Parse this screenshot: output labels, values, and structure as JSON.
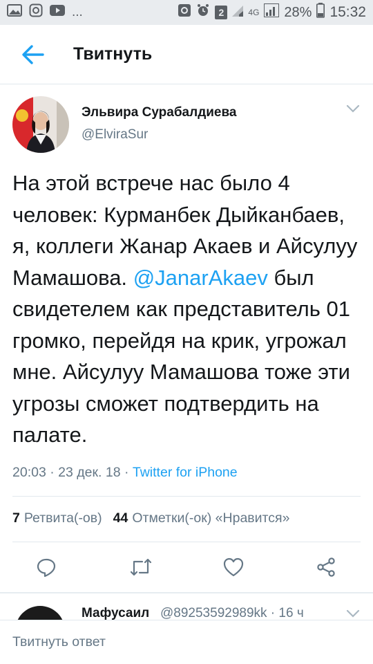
{
  "status_bar": {
    "left_icons": [
      "image-icon",
      "instagram-icon",
      "youtube-icon",
      "more-dots"
    ],
    "dots": "...",
    "sim_badge": "2",
    "network": "4G",
    "battery_percent": "28%",
    "time": "15:32"
  },
  "app_bar": {
    "title": "Твитнуть",
    "back_icon": "arrow-left-icon"
  },
  "tweet": {
    "author_name": "Эльвира Сурабалдиева",
    "author_handle": "@ElviraSur",
    "text_before": "На этой встрече нас было 4 человек: Курманбек Дыйканбаев, я, коллеги Жанар Акаев и Айсулуу Мамашова.",
    "mention": "@JanarAkaev",
    "text_after": "был свидетелем как представитель 01 громко, перейдя на крик, угрожал мне. Айсулуу Мамашова тоже эти угрозы сможет подтвердить на палате.",
    "time": "20:03",
    "date": "23 дек. 18",
    "separator": " · ",
    "source": "Twitter for iPhone",
    "retweets_count": "7",
    "retweets_label": "Ретвита(-ов)",
    "likes_count": "44",
    "likes_label": "Отметки(-ок) «Нравится»"
  },
  "actions": [
    "reply-icon",
    "retweet-icon",
    "like-icon",
    "share-icon"
  ],
  "next_reply": {
    "name": "Мафусаил",
    "handle_meta": "@89253592989kk · 16 ч"
  },
  "compose": {
    "placeholder": "Твитнуть ответ"
  },
  "colors": {
    "accent": "#1da1f2",
    "text": "#14171a",
    "secondary": "#657786",
    "status_bar": "#e9ecef"
  }
}
